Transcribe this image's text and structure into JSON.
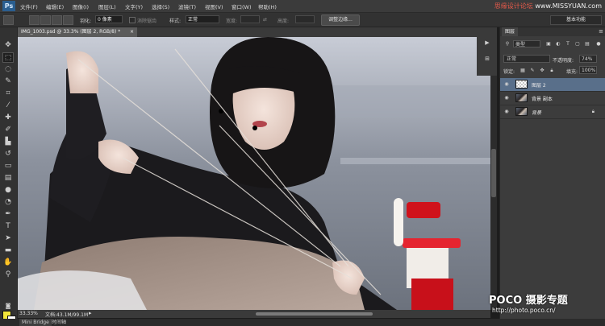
{
  "app": {
    "logo": "Ps",
    "menus": [
      "文件(F)",
      "编辑(E)",
      "图像(I)",
      "图层(L)",
      "文字(Y)",
      "选择(S)",
      "滤镜(T)",
      "视图(V)",
      "窗口(W)",
      "帮助(H)"
    ],
    "site_watermark": {
      "part1": "思缘设计论坛",
      "part2": "www.MISSYUAN.com"
    }
  },
  "options_bar": {
    "feather_label": "羽化:",
    "feather_value": "0 像素",
    "antialias_label": "消除锯齿",
    "style_label": "样式:",
    "style_value": "正常",
    "width_label": "宽度:",
    "height_label": "高度:",
    "refine_edge": "调整边缘...",
    "workspace": "基本功能"
  },
  "document": {
    "tab_title": "IMG_1003.psd @ 33.3% (图层 2, RGB/8) *",
    "tab_close": "×",
    "zoom": "33.33%",
    "doc_size": "文档:43.1M/99.1M",
    "status_arrow": "▸"
  },
  "bottom_tabs": {
    "mini_bridge": "Mini Bridge",
    "timeline": "时间轴"
  },
  "layers_panel": {
    "tab": "图层",
    "menu_icon": "≡",
    "filter_type": "类型",
    "blend_mode": "正常",
    "opacity_label": "不透明度:",
    "opacity_value": "74%",
    "lock_label": "锁定:",
    "fill_label": "填充:",
    "fill_value": "100%",
    "layers": [
      {
        "name": "图层 2",
        "selected": true,
        "thumb": "checker",
        "locked": false,
        "italic": false
      },
      {
        "name": "背景 副本",
        "selected": false,
        "thumb": "photo",
        "locked": false,
        "italic": false
      },
      {
        "name": "背景",
        "selected": false,
        "thumb": "photo",
        "locked": true,
        "italic": true
      }
    ]
  },
  "colors": {
    "foreground": "#f2e63a",
    "background": "#ffffff",
    "accent_selected": "#596f8a"
  },
  "poco_watermark": {
    "title": "POCO 摄影专题",
    "url": "http://photo.poco.cn/"
  }
}
